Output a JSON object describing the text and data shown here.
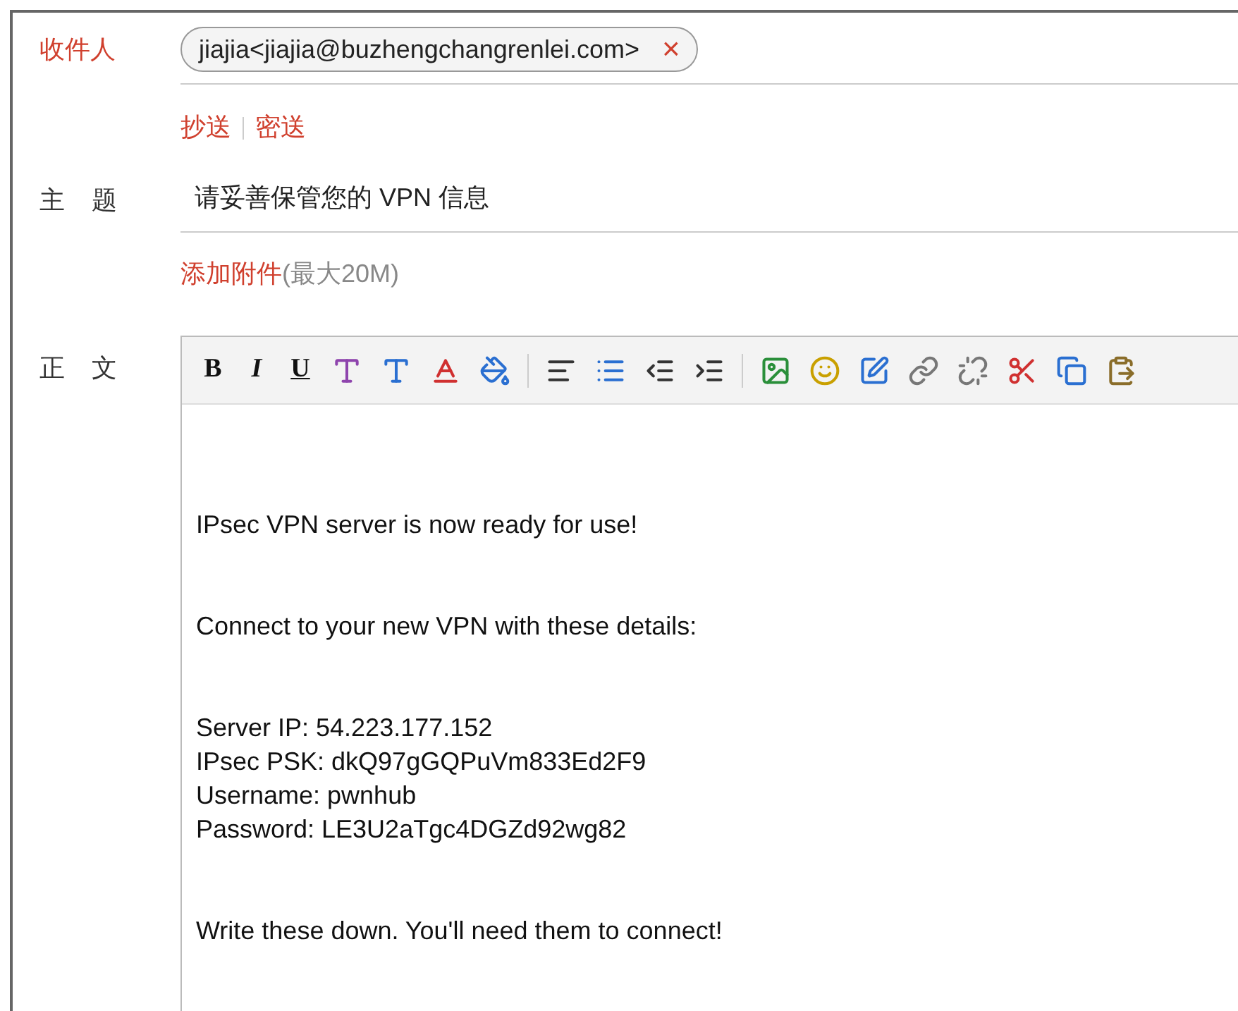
{
  "recipient": {
    "label": "收件人",
    "chips": [
      {
        "text": "jiajia<jiajia@buzhengchangrenlei.com>",
        "remove": "×"
      }
    ]
  },
  "copy_links": [
    {
      "text": "抄送"
    },
    {
      "text": "密送"
    }
  ],
  "subject": {
    "label": "主 题",
    "value": "请妥善保管您的 VPN 信息"
  },
  "attachment": {
    "link": "添加附件",
    "hint": "(最大20M)"
  },
  "body": {
    "label": "正 文",
    "toolbar": [
      {
        "kind": "bold",
        "label": "B"
      },
      {
        "kind": "italic",
        "label": "I"
      },
      {
        "kind": "underline",
        "label": "U"
      },
      {
        "kind": "font"
      },
      {
        "kind": "size"
      },
      {
        "kind": "color"
      },
      {
        "kind": "fill"
      },
      {
        "kind": "sep"
      },
      {
        "kind": "align"
      },
      {
        "kind": "list"
      },
      {
        "kind": "outdent"
      },
      {
        "kind": "indent"
      },
      {
        "kind": "sep"
      },
      {
        "kind": "image"
      },
      {
        "kind": "emoji"
      },
      {
        "kind": "table"
      },
      {
        "kind": "link"
      },
      {
        "kind": "unlink"
      },
      {
        "kind": "cut"
      },
      {
        "kind": "copy"
      },
      {
        "kind": "paste"
      }
    ],
    "paragraphs": [
      [
        "IPsec VPN server is now ready for use!"
      ],
      [
        "Connect to your new VPN with these details:"
      ],
      [
        "Server IP: 54.223.177.152",
        "IPsec PSK: dkQ97gGQPuVm833Ed2F9",
        "Username: pwnhub",
        "Password: LE3U2aTgc4DGZd92wg82"
      ],
      [
        "Write these down. You'll need them to connect!"
      ]
    ]
  }
}
